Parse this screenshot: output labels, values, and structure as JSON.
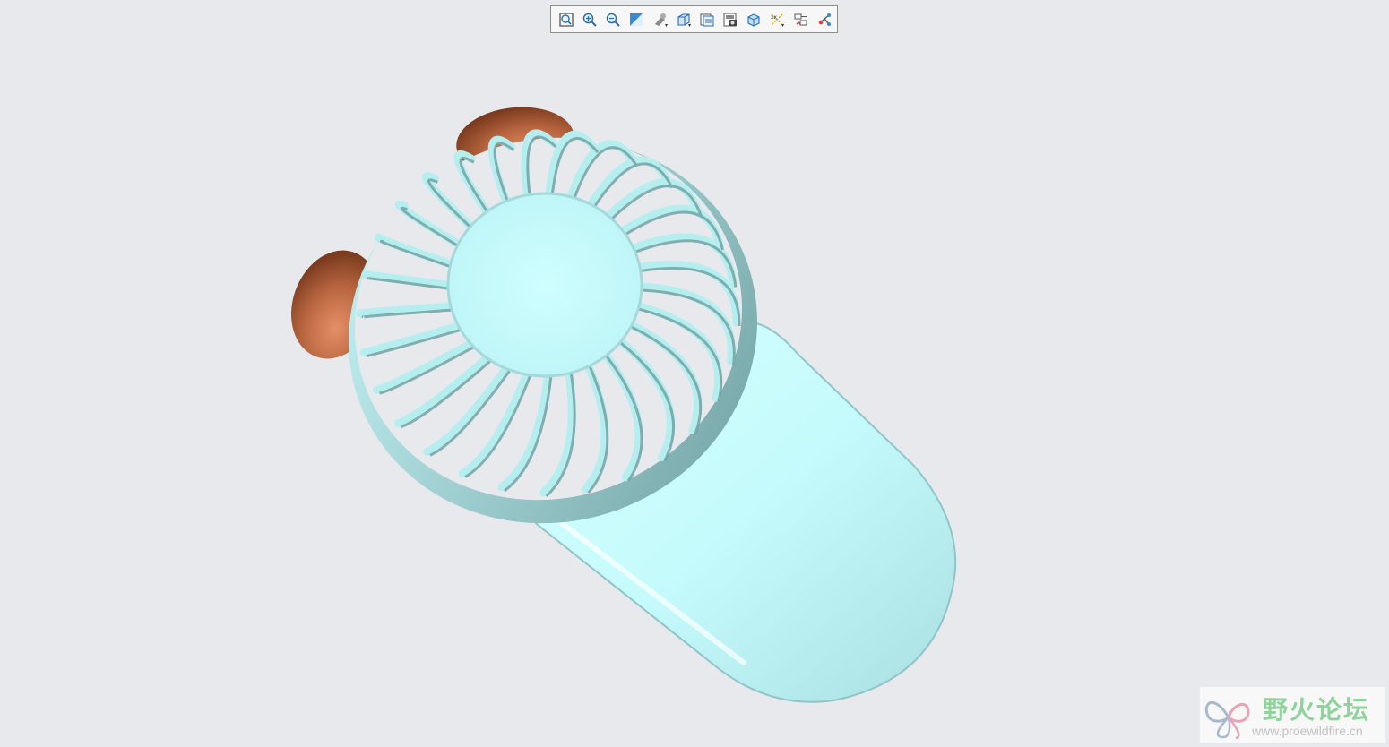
{
  "toolbar": {
    "buttons": [
      {
        "name": "refit-icon"
      },
      {
        "name": "zoom-in-icon"
      },
      {
        "name": "zoom-out-icon"
      },
      {
        "name": "repaint-icon"
      },
      {
        "name": "display-style-icon"
      },
      {
        "name": "saved-orientations-icon"
      },
      {
        "name": "view-manager-icon"
      },
      {
        "name": "section-icon"
      },
      {
        "name": "appearance-icon"
      },
      {
        "name": "datum-display-icon"
      },
      {
        "name": "annotation-display-icon"
      },
      {
        "name": "spin-center-icon"
      }
    ]
  },
  "model": {
    "body_color": "#c8fbfc",
    "shadow_color": "#7fb3b5",
    "ear_color": "#b6633f"
  },
  "watermark": {
    "title": "野火论坛",
    "url": "www.proewildfire.cn"
  }
}
